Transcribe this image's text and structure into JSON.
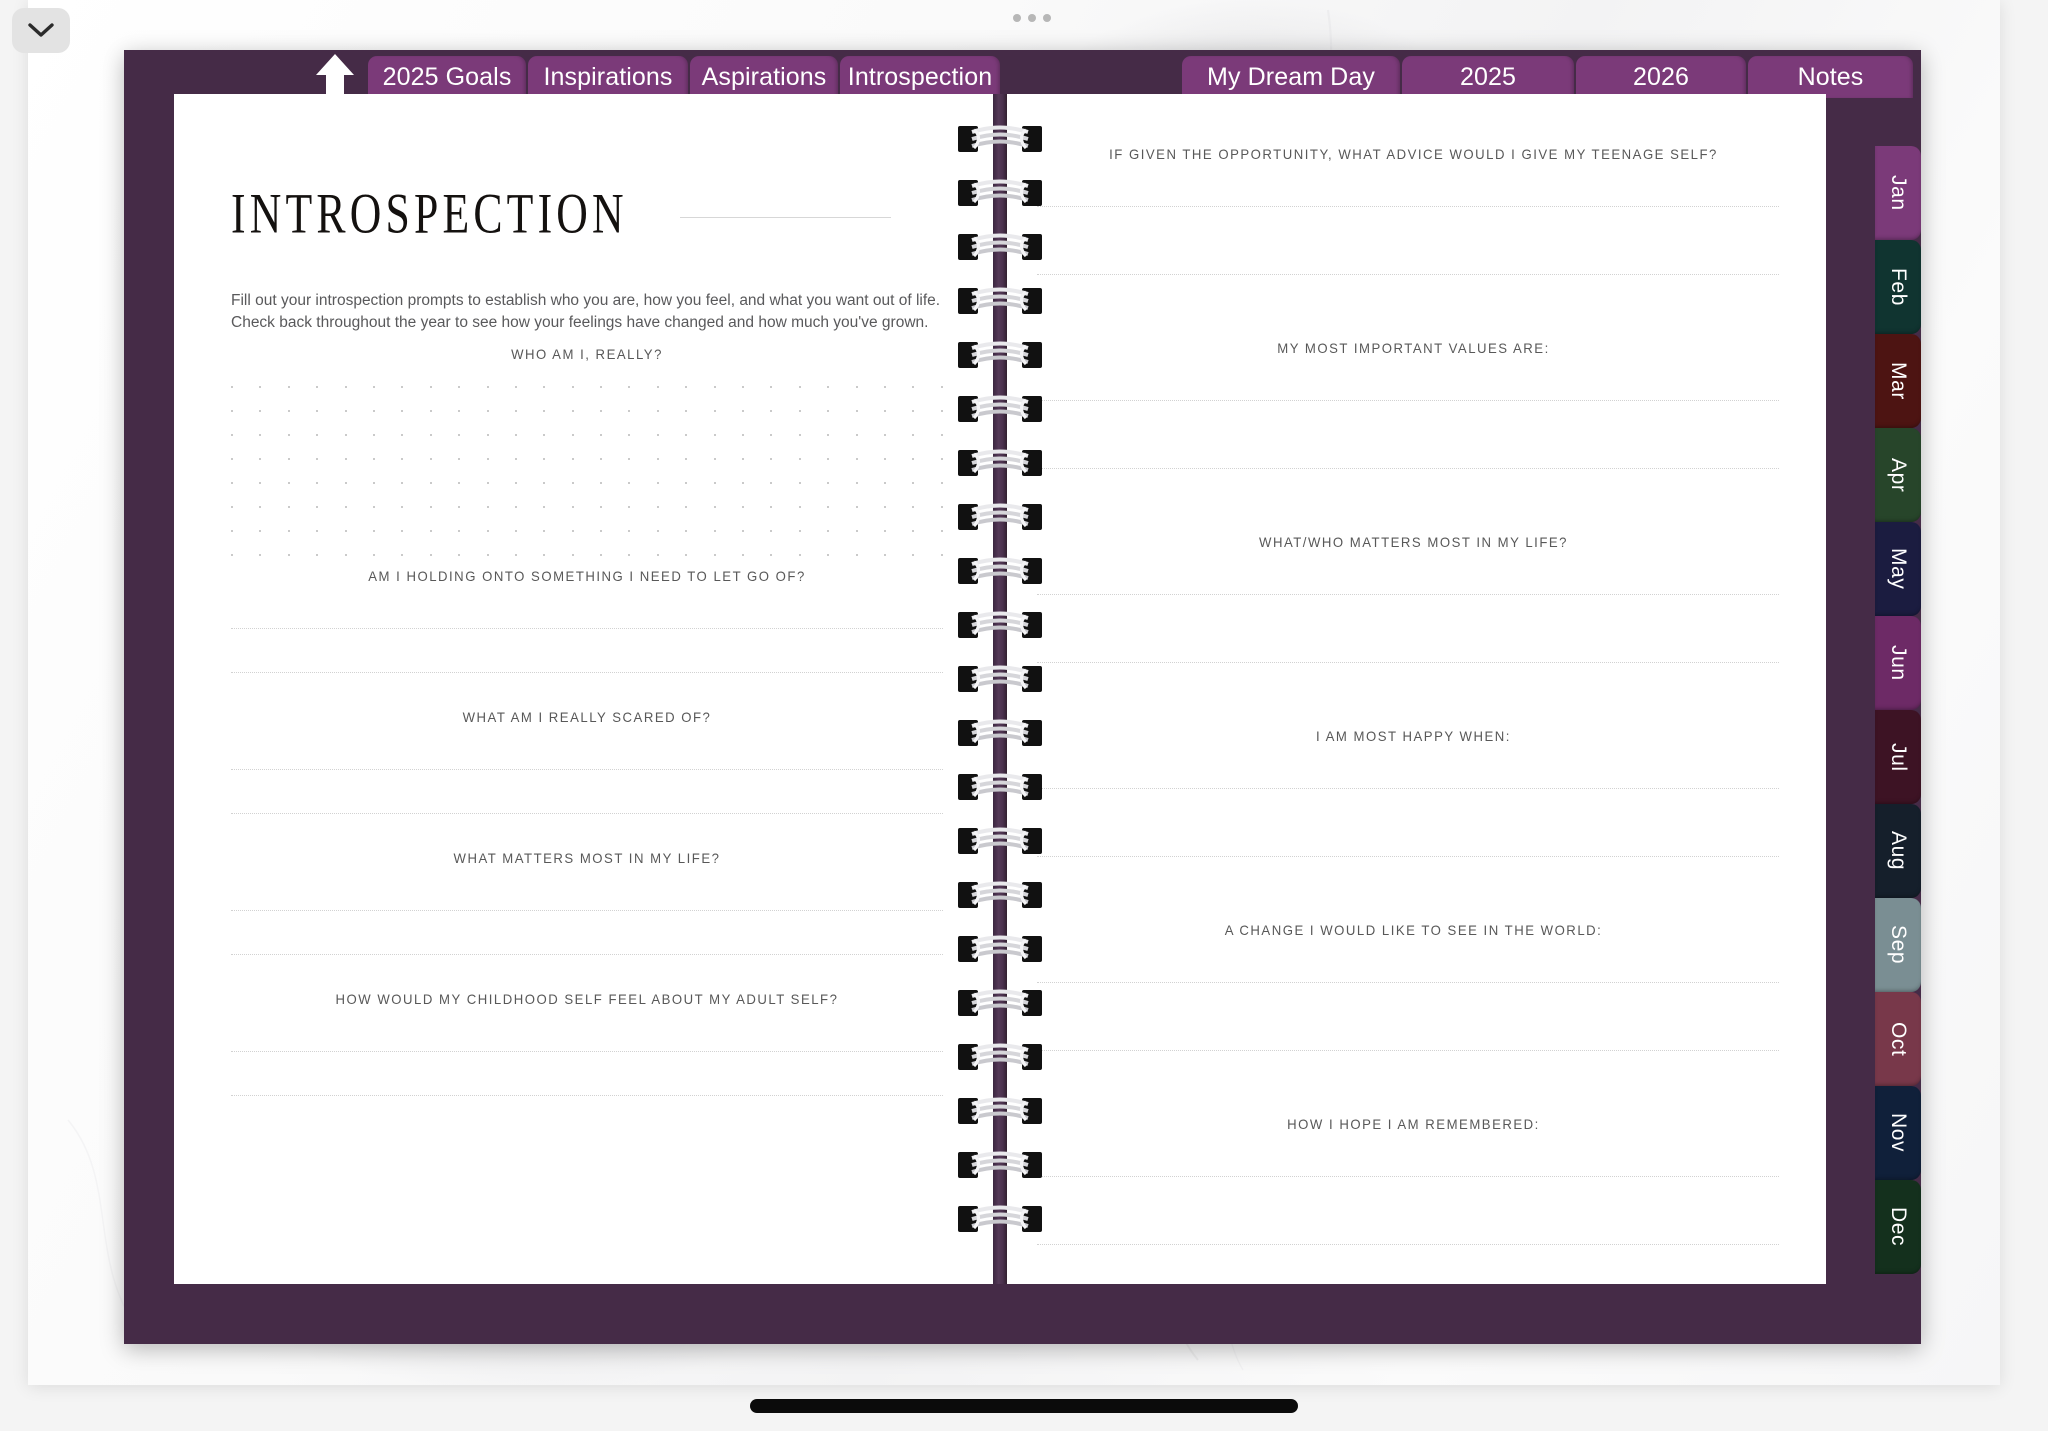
{
  "device": {
    "collapse_icon": "chevron-down-icon",
    "more_handle_icon": "three-dots-handle-icon",
    "home_indicator": "home-indicator-bar"
  },
  "planner": {
    "cover_color": "#452b47",
    "tab_color": "#7b3a79",
    "home_icon": "up-arrow-home-icon",
    "section_tabs_left": [
      {
        "label": "2025 Goals",
        "active": false
      },
      {
        "label": "Inspirations",
        "active": false
      },
      {
        "label": "Aspirations",
        "active": false
      },
      {
        "label": "Introspection",
        "active": true
      }
    ],
    "section_tabs_right": [
      {
        "label": "My Dream Day",
        "active": false
      },
      {
        "label": "2025",
        "active": false
      },
      {
        "label": "2026",
        "active": false
      },
      {
        "label": "Notes",
        "active": false
      }
    ],
    "month_tabs": [
      {
        "label": "Jan",
        "color": "#7b3a79"
      },
      {
        "label": "Feb",
        "color": "#103430"
      },
      {
        "label": "Mar",
        "color": "#4d1412"
      },
      {
        "label": "Apr",
        "color": "#27452a"
      },
      {
        "label": "May",
        "color": "#1b1c40"
      },
      {
        "label": "Jun",
        "color": "#6d2a66"
      },
      {
        "label": "Jul",
        "color": "#3d1324"
      },
      {
        "label": "Aug",
        "color": "#151f2b"
      },
      {
        "label": "Sep",
        "color": "#7a8e93"
      },
      {
        "label": "Oct",
        "color": "#78384a"
      },
      {
        "label": "Nov",
        "color": "#10203a"
      },
      {
        "label": "Dec",
        "color": "#14301d"
      }
    ]
  },
  "left_page": {
    "title": "INTROSPECTION",
    "intro": "Fill out your introspection prompts to establish who you are, how you feel, and what you want out of life. Check back throughout the year to see how your feelings have changed and how much you've grown.",
    "dot_grid_rows": 8,
    "dot_grid_cols": 26,
    "prompts": [
      {
        "label": "WHO AM I, REALLY?",
        "type": "dotgrid"
      },
      {
        "label": "AM I HOLDING ONTO SOMETHING I NEED TO LET GO OF?",
        "type": "lines"
      },
      {
        "label": "WHAT AM I REALLY SCARED OF?",
        "type": "lines"
      },
      {
        "label": "WHAT MATTERS MOST IN MY LIFE?",
        "type": "lines"
      },
      {
        "label": "HOW WOULD MY CHILDHOOD SELF FEEL ABOUT MY ADULT SELF?",
        "type": "lines"
      }
    ]
  },
  "right_page": {
    "prompts": [
      {
        "label": "IF GIVEN THE OPPORTUNITY, WHAT ADVICE WOULD I GIVE MY TEENAGE SELF?",
        "type": "lines"
      },
      {
        "label": "MY MOST IMPORTANT VALUES ARE:",
        "type": "lines"
      },
      {
        "label": "WHAT/WHO MATTERS MOST IN MY LIFE?",
        "type": "lines"
      },
      {
        "label": "I AM MOST HAPPY WHEN:",
        "type": "lines"
      },
      {
        "label": "A CHANGE I WOULD LIKE TO SEE IN THE WORLD:",
        "type": "lines"
      },
      {
        "label": "HOW I HOPE I AM REMEMBERED:",
        "type": "lines"
      }
    ]
  }
}
